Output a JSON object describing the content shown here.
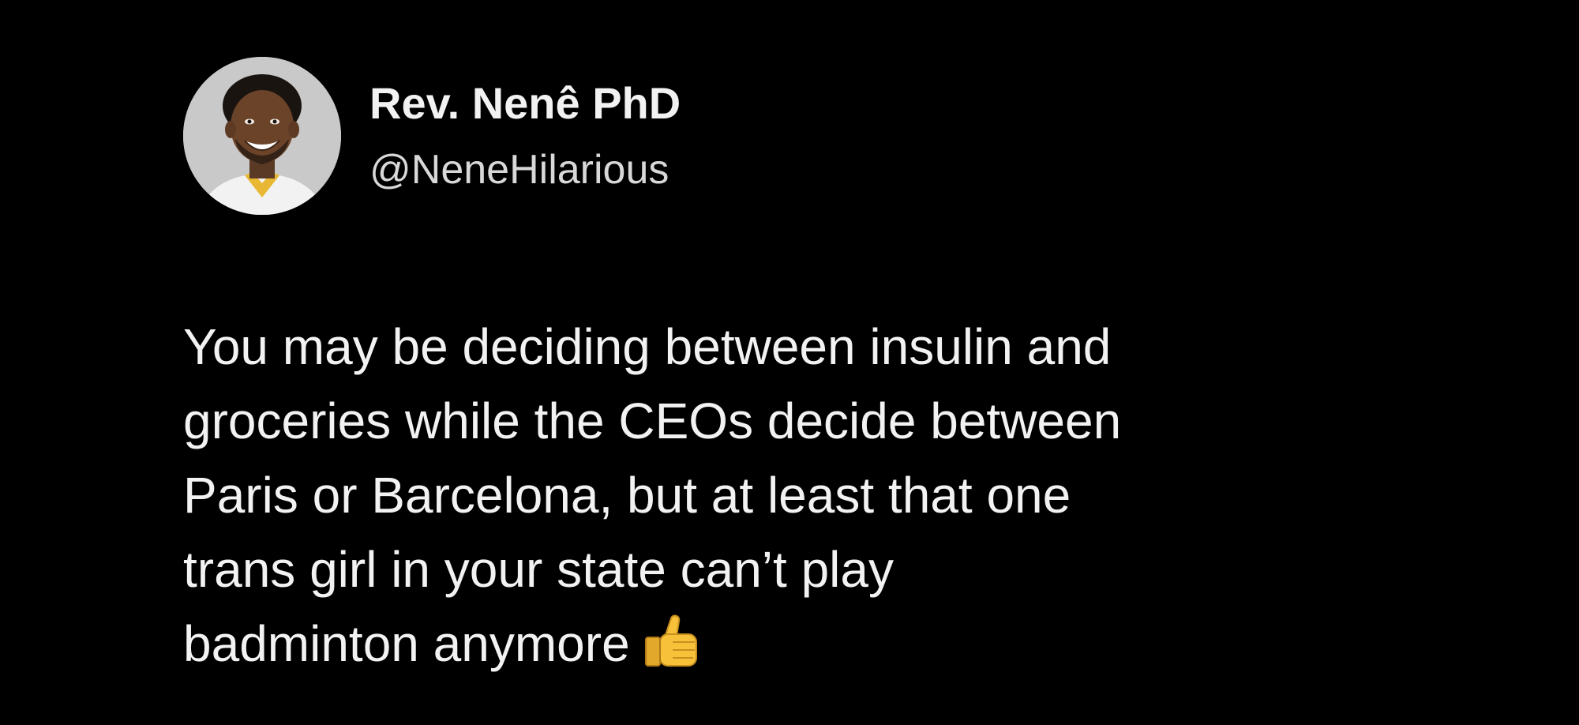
{
  "author": {
    "display_name": "Rev. Nenê PhD",
    "handle": "@NeneHilarious",
    "avatar": "avatar-photo"
  },
  "tweet": {
    "lines": [
      "You may be deciding between insulin and",
      "groceries while the CEOs decide between",
      "Paris or Barcelona, but at least that one",
      "trans girl in your state can’t play",
      "badminton anymore"
    ],
    "trailing_emoji": "thumbs-up-icon"
  },
  "colors": {
    "background": "#000000",
    "text": "#f2f2f2",
    "handle": "#d8d8d8",
    "emoji": "#f7c23a"
  }
}
